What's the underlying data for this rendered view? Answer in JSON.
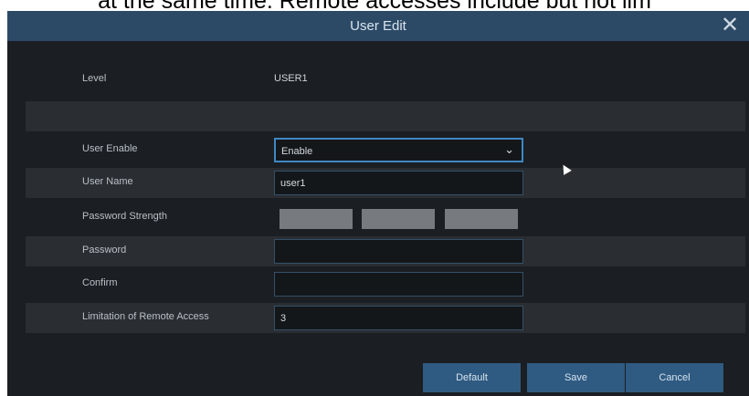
{
  "background_text": "at the same time. Remote accesses include but not lim",
  "dialog": {
    "title": "User Edit",
    "close_icon": "close-icon"
  },
  "form": {
    "level_label": "Level",
    "level_value": "USER1",
    "user_enable_label": "User Enable",
    "user_enable_value": "Enable",
    "user_name_label": "User Name",
    "user_name_value": "user1",
    "password_strength_label": "Password Strength",
    "password_label": "Password",
    "password_value": "",
    "confirm_label": "Confirm",
    "confirm_value": "",
    "remote_access_label": "Limitation of Remote Access",
    "remote_access_value": "3"
  },
  "buttons": {
    "default": "Default",
    "save": "Save",
    "cancel": "Cancel"
  },
  "colors": {
    "titlebar": "#2c4a66",
    "panel": "#1b1e22",
    "button": "#2f5b82",
    "select_border": "#3f88c5"
  }
}
